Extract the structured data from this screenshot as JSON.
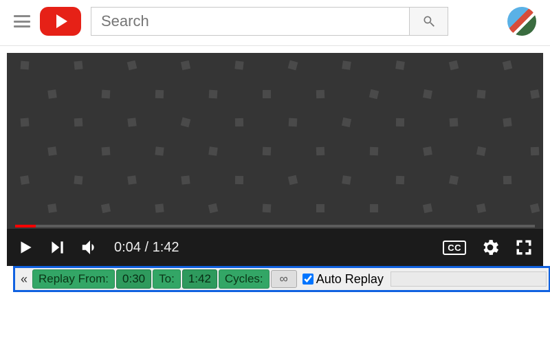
{
  "header": {
    "search_placeholder": "Search"
  },
  "player": {
    "current_time": "0:04",
    "duration": "1:42",
    "cc_label": "CC"
  },
  "replay": {
    "collapse": "«",
    "from_label": "Replay From:",
    "from_value": "0:30",
    "to_label": "To:",
    "to_value": "1:42",
    "cycles_label": "Cycles:",
    "cycles_value": "∞",
    "auto_label": "Auto Replay",
    "auto_checked": true
  }
}
